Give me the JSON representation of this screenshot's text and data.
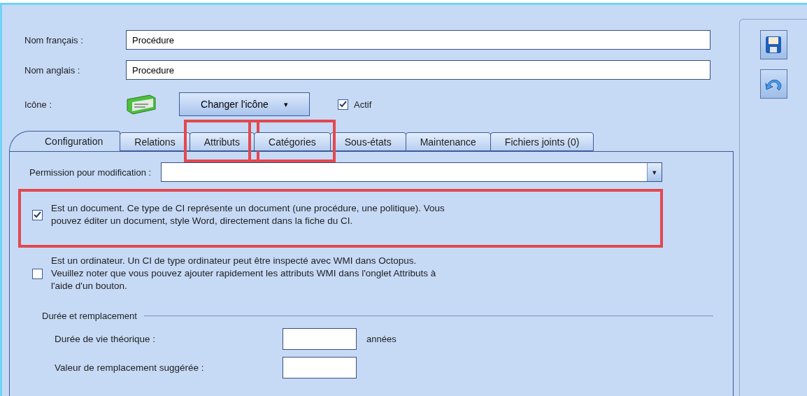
{
  "fields": [
    {
      "label": "Nom français :",
      "value": "Procédure"
    },
    {
      "label": "Nom anglais :",
      "value": "Procedure"
    }
  ],
  "icon_row": {
    "label": "Icône :",
    "button": "Changer l'icône",
    "caret": "▾",
    "active": {
      "label": "Actif",
      "checked": true
    }
  },
  "tabs": [
    {
      "label": "Configuration",
      "selected": true,
      "highlighted": false
    },
    {
      "label": "Relations",
      "selected": false,
      "highlighted": false
    },
    {
      "label": "Attributs",
      "selected": false,
      "highlighted": true
    },
    {
      "label": "Catégories",
      "selected": false,
      "highlighted": true
    },
    {
      "label": "Sous-états",
      "selected": false,
      "highlighted": false
    },
    {
      "label": "Maintenance",
      "selected": false,
      "highlighted": false
    },
    {
      "label": "Fichiers joints (0)",
      "selected": false,
      "highlighted": false
    }
  ],
  "permission": {
    "label": "Permission pour modification :",
    "caret": "▾"
  },
  "options": [
    {
      "text": "Est un document. Ce type de CI représente un document (une procédure, une politique). Vous\npouvez éditer un document, style Word, directement dans la fiche du CI.",
      "checked": true,
      "highlighted": true
    },
    {
      "text": "Est un ordinateur. Un CI de type ordinateur peut être inspecté avec WMI dans Octopus.\nVeuillez noter que vous pouvez ajouter rapidement les attributs WMI dans l'onglet Attributs à\nl'aide d'un bouton.",
      "checked": false,
      "highlighted": false
    }
  ],
  "group": {
    "title": "Durée et remplacement",
    "rows": [
      {
        "label": "Durée de vie théorique :",
        "unit": "années"
      },
      {
        "label": "Valeur de remplacement suggérée :"
      }
    ]
  }
}
